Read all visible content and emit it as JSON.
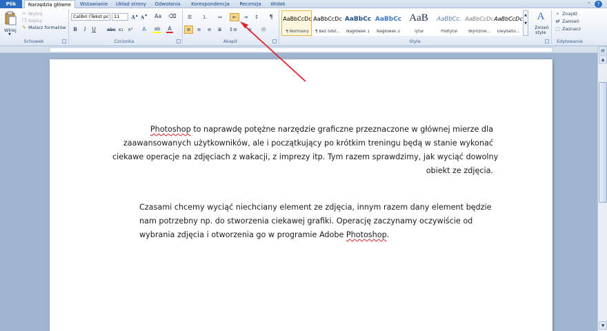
{
  "tabs": {
    "file": "Plik",
    "home": "Narzędzia główne",
    "insert": "Wstawianie",
    "layout": "Układ strony",
    "references": "Odwołania",
    "mailings": "Korespondencja",
    "review": "Recenzja",
    "view": "Widok"
  },
  "clipboard": {
    "paste": "Wklej",
    "cut": "Wytnij",
    "copy": "Kopiuj",
    "format_painter": "Malarz formatów",
    "group_label": "Schowek"
  },
  "font": {
    "name": "Calibri (Tekst pc",
    "size": "11",
    "group_label": "Czcionka"
  },
  "paragraph": {
    "group_label": "Akapit"
  },
  "styles": {
    "items": [
      {
        "sample": "AaBbCcDc",
        "name": "¶ Normalny"
      },
      {
        "sample": "AaBbCcDc",
        "name": "¶ Bez odst..."
      },
      {
        "sample": "AaBbCc",
        "name": "Nagłówek 1"
      },
      {
        "sample": "AaBbCc",
        "name": "Nagłówek 2"
      },
      {
        "sample": "AaB",
        "name": "Tytuł"
      },
      {
        "sample": "AaBbCc.",
        "name": "Podtytuł"
      },
      {
        "sample": "AaBbCcDc",
        "name": "Wyróżnie..."
      },
      {
        "sample": "AaBbCcDc",
        "name": "Uwydatni..."
      }
    ],
    "change_styles_1": "Zmień",
    "change_styles_2": "style",
    "group_label": "Style"
  },
  "editing": {
    "find": "Znajdź",
    "replace": "Zamień",
    "select": "Zaznacz",
    "group_label": "Edytowanie"
  },
  "document": {
    "para1": {
      "line1_word": "Photoshop",
      "line1_rest": " to naprawdę potężne narzędzie graficzne przeznaczone w głównej mierze dla",
      "line2": "zaawansowanych użytkowników, ale i początkujący po krótkim treningu będą w stanie wykonać",
      "line3": "ciekawe operacje na zdjęciach z wakacji, z imprezy itp. Tym razem sprawdzimy, jak wyciąć dowolny",
      "line4": "obiekt ze zdjęcia."
    },
    "para2": {
      "line1": "Czasami chcemy wyciąć niechciany element ze zdjęcia, innym razem dany element będzie",
      "line2": "nam potrzebny np. do stworzenia ciekawej grafiki. Operację zaczynamy oczywiście od",
      "line3_start": "wybrania zdjęcia i otworzenia go w programie Adobe ",
      "line3_word": "Photoshop",
      "line3_end": "."
    }
  },
  "colors": {
    "annotation_arrow": "#e0202a",
    "file_tab": "#2a6cc1",
    "spelling_squiggle": "#dd2222"
  }
}
